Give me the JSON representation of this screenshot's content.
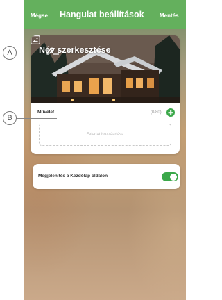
{
  "header": {
    "cancel_label": "Mégse",
    "title": "Hangulat beállítások",
    "save_label": "Mentés",
    "color": "#64b05d"
  },
  "scene_card": {
    "name_text": "Név szerkesztése",
    "edit_icon": "pencil-icon",
    "image_icon": "image-icon",
    "action_label": "Művelet",
    "action_count": "(0/80)",
    "add_icon": "plus-circle-icon",
    "task_placeholder": "Feladat hozzáadása"
  },
  "home_card": {
    "label": "Megjelenítés a Kezdőlap oldalon",
    "toggle_on": true,
    "accent": "#3ba84a"
  },
  "callouts": {
    "a": "A",
    "b": "B"
  }
}
